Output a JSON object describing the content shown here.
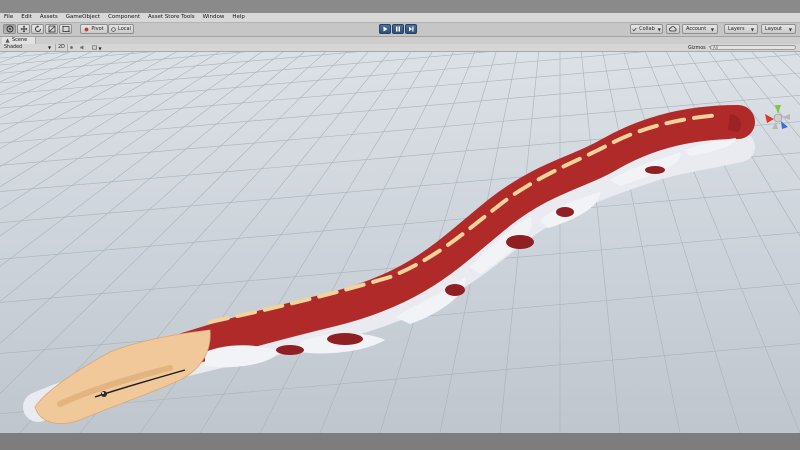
{
  "menu": {
    "items": [
      "File",
      "Edit",
      "Assets",
      "GameObject",
      "Component",
      "Asset Store Tools",
      "Window",
      "Help"
    ]
  },
  "toolbar": {
    "tools": [
      "hand-tool",
      "move-tool",
      "rotate-tool",
      "scale-tool",
      "rect-tool"
    ],
    "active_tool": "hand-tool",
    "pivot_label": "Pivot",
    "local_label": "Local",
    "collab_label": "Collab",
    "account_label": "Account",
    "layers_label": "Layers",
    "layout_label": "Layout"
  },
  "scene": {
    "tab_label": "Scene",
    "shading_mode": "Shaded",
    "mode_2d_label": "2D",
    "gizmos_label": "Gizmos",
    "search_placeholder": "All"
  },
  "colors": {
    "sky": "#dfe3e8",
    "ground": "#bcc3cb",
    "grid": "#a9b1ba",
    "snake_red": "#b02a2a",
    "snake_dark_red": "#8f1f22",
    "snake_white": "#f2f3f7",
    "snake_cream": "#f2d49a",
    "snake_head": "#f0c89a",
    "gizmo_x": "#d93a2b",
    "gizmo_y": "#7ac943",
    "gizmo_z": "#3b6fd6",
    "play_blue": "#3a5c8c"
  }
}
